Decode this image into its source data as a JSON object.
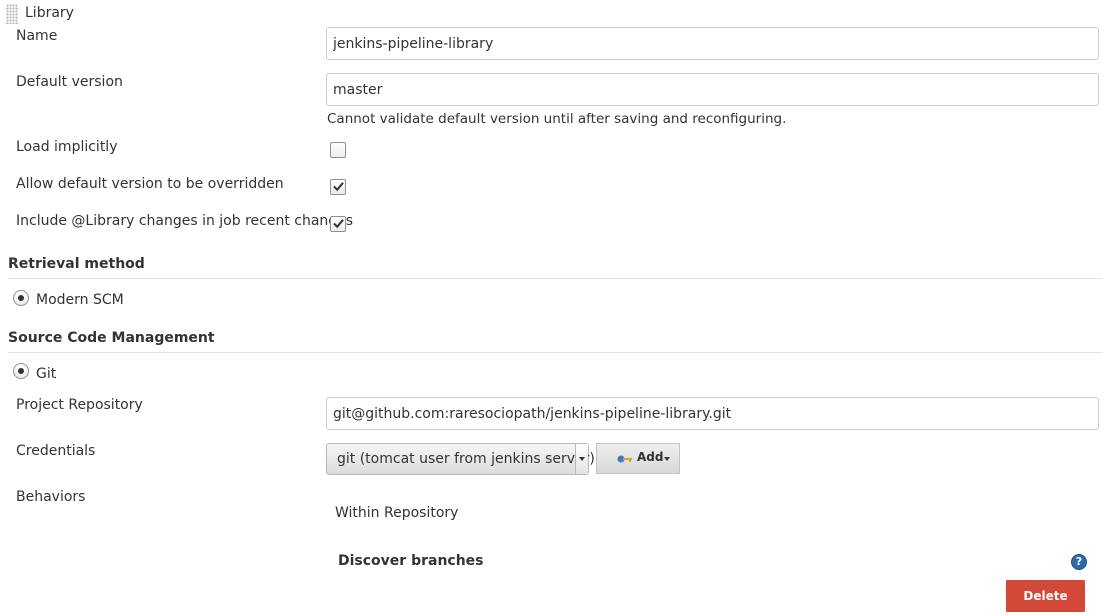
{
  "library": {
    "header_label": "Library",
    "name_label": "Name",
    "name_value": "jenkins-pipeline-library",
    "default_version_label": "Default version",
    "default_version_value": "master",
    "default_version_note": "Cannot validate default version until after saving and reconfiguring.",
    "load_implicitly_label": "Load implicitly",
    "load_implicitly_checked": false,
    "allow_override_label": "Allow default version to be overridden",
    "allow_override_checked": true,
    "include_changes_label": "Include @Library changes in job recent changes",
    "include_changes_checked": true
  },
  "retrieval": {
    "section_title": "Retrieval method",
    "option_label": "Modern SCM"
  },
  "scm": {
    "section_title": "Source Code Management",
    "option_label": "Git",
    "project_repository_label": "Project Repository",
    "project_repository_value": "git@github.com:raresociopath/jenkins-pipeline-library.git",
    "credentials_label": "Credentials",
    "credentials_selected": "git (tomcat user from jenkins server)",
    "add_button_label": "Add",
    "behaviors_label": "Behaviors",
    "within_repository_label": "Within Repository",
    "discover_branches_label": "Discover branches",
    "delete_button_label": "Delete"
  },
  "colors": {
    "delete_button": "#d24939",
    "help_icon": "#2e6aa8",
    "rule": "#e2e2e2"
  },
  "icons": {
    "drag_handle": "drag-handle-icon",
    "checkbox_mark": "checkmark-icon",
    "key": "key-icon",
    "help": "help-icon"
  }
}
